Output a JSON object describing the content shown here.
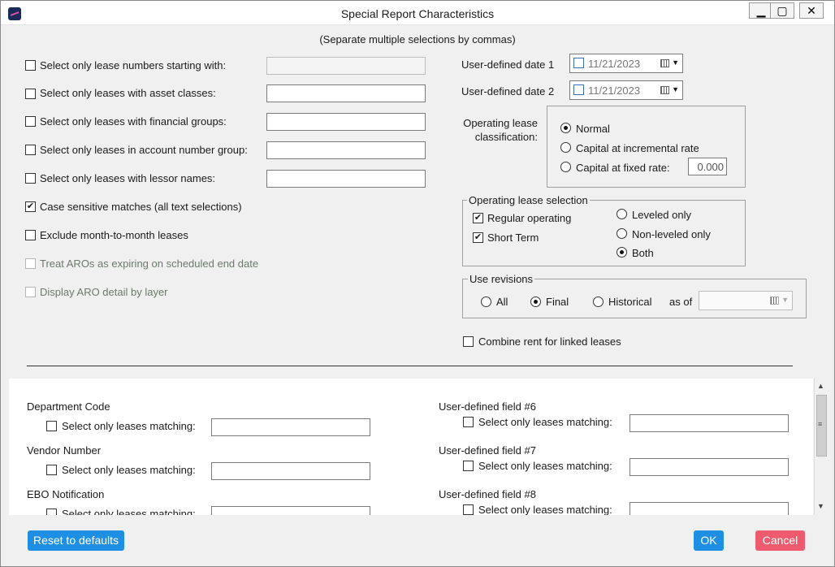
{
  "window": {
    "title": "Special Report Characteristics",
    "minimize": "▁",
    "maximize": "▢",
    "close": "✕"
  },
  "header_note": "(Separate multiple selections by commas)",
  "left_options": [
    {
      "label": "Select only lease numbers starting with:",
      "checked": false,
      "enabled": true,
      "has_input": true,
      "input_value": ""
    },
    {
      "label": "Select only leases with asset classes:",
      "checked": false,
      "enabled": true,
      "has_input": true,
      "input_value": ""
    },
    {
      "label": "Select only leases with financial groups:",
      "checked": false,
      "enabled": true,
      "has_input": true,
      "input_value": ""
    },
    {
      "label": "Select only leases in account number group:",
      "checked": false,
      "enabled": true,
      "has_input": true,
      "input_value": ""
    },
    {
      "label": "Select only leases with lessor names:",
      "checked": false,
      "enabled": true,
      "has_input": true,
      "input_value": ""
    },
    {
      "label": "Case sensitive matches (all text selections)",
      "checked": true,
      "enabled": true,
      "has_input": false
    },
    {
      "label": "Exclude month-to-month leases",
      "checked": false,
      "enabled": true,
      "has_input": false
    },
    {
      "label": "Treat AROs as expiring on scheduled end date",
      "checked": false,
      "enabled": false,
      "has_input": false
    },
    {
      "label": "Display ARO detail by layer",
      "checked": false,
      "enabled": false,
      "has_input": false
    }
  ],
  "dates": [
    {
      "label": "User-defined date 1",
      "value": "11/21/2023"
    },
    {
      "label": "User-defined date 2",
      "value": "11/21/2023"
    }
  ],
  "classification": {
    "label": "Operating lease classification:",
    "options": [
      {
        "label": "Normal",
        "selected": true
      },
      {
        "label": "Capital at incremental rate",
        "selected": false
      },
      {
        "label": "Capital at fixed rate:",
        "selected": false
      }
    ],
    "fixed_rate_value": "0.000"
  },
  "op_selection": {
    "title": "Operating lease selection",
    "checks": [
      {
        "label": "Regular operating",
        "checked": true
      },
      {
        "label": "Short Term",
        "checked": true
      }
    ],
    "radios": [
      {
        "label": "Leveled only",
        "selected": false
      },
      {
        "label": "Non-leveled only",
        "selected": false
      },
      {
        "label": "Both",
        "selected": true
      }
    ]
  },
  "revisions": {
    "title": "Use revisions",
    "options": [
      {
        "label": "All",
        "selected": false
      },
      {
        "label": "Final",
        "selected": true
      },
      {
        "label": "Historical",
        "selected": false
      }
    ],
    "as_of_label": "as of",
    "as_of_value": ""
  },
  "combine_rent": {
    "label": "Combine rent for linked leases",
    "checked": false
  },
  "custom_fields_left": [
    {
      "title": "Department Code",
      "match_label": "Select only leases matching:",
      "value": ""
    },
    {
      "title": "Vendor Number",
      "match_label": "Select only leases matching:",
      "value": ""
    },
    {
      "title": "EBO Notification",
      "match_label": "Select only leases matching:",
      "value": ""
    }
  ],
  "custom_fields_right": [
    {
      "title": "User-defined field #6",
      "match_label": "Select only leases matching:",
      "value": ""
    },
    {
      "title": "User-defined field #7",
      "match_label": "Select only leases matching:",
      "value": ""
    },
    {
      "title": "User-defined field #8",
      "match_label": "Select only leases matching:",
      "value": ""
    }
  ],
  "scroll": {
    "up": "▲",
    "down": "▼",
    "grip": "≡"
  },
  "buttons": {
    "reset": "Reset to defaults",
    "ok": "OK",
    "cancel": "Cancel"
  },
  "colors": {
    "primary": "#1e8fe3",
    "danger": "#ee5a6e"
  }
}
